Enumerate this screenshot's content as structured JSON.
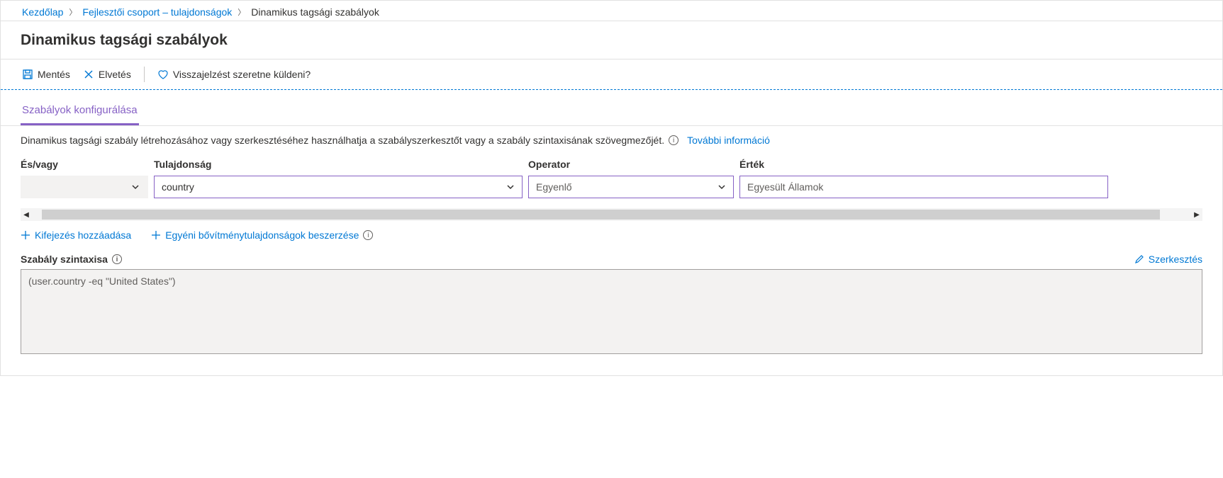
{
  "breadcrumb": {
    "home": "Kezdőlap",
    "group": "Fejlesztői csoport – tulajdonságok",
    "current": "Dinamikus tagsági szabályok"
  },
  "title": "Dinamikus tagsági szabályok",
  "toolbar": {
    "save": "Mentés",
    "discard": "Elvetés",
    "feedback": "Visszajelzést szeretne küldeni?"
  },
  "tabs": {
    "configure": "Szabályok konfigurálása"
  },
  "description": "Dinamikus tagsági szabály létrehozásához vagy szerkesztéséhez használhatja a szabályszerkesztőt vagy a szabály szintaxisának szövegmezőjét.",
  "more_info": "További információ",
  "builder": {
    "headers": {
      "andor": "És/vagy",
      "property": "Tulajdonság",
      "operator": "Operator",
      "value": "Érték"
    },
    "row": {
      "property": "country",
      "operator": "Egyenlő",
      "value": "Egyesült Államok"
    },
    "add_expression": "Kifejezés hozzáadása",
    "custom_ext": "Egyéni bővítménytulajdonságok beszerzése"
  },
  "syntax": {
    "label": "Szabály szintaxisa",
    "edit": "Szerkesztés",
    "value": "(user.country -eq \"United States\")"
  }
}
